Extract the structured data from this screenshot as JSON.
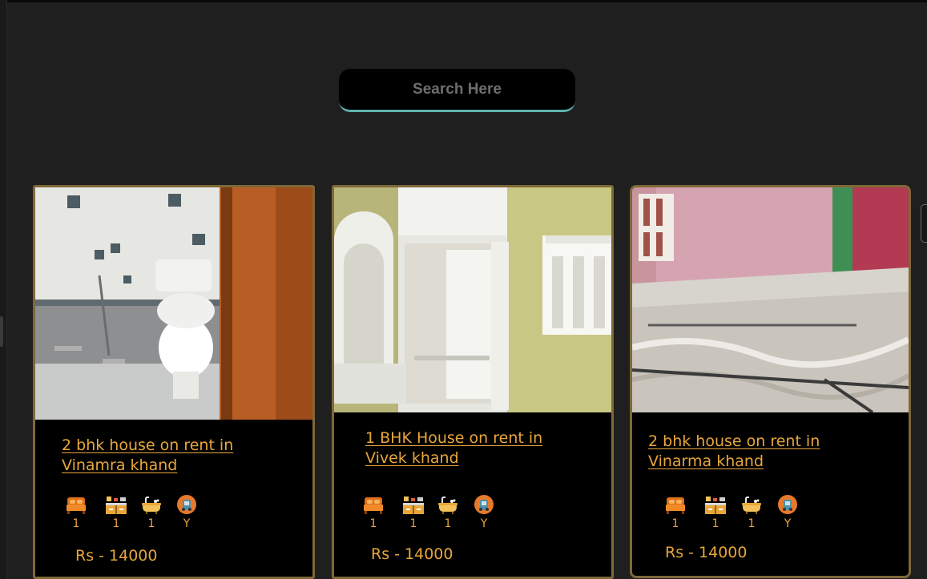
{
  "search": {
    "placeholder": "Search Here"
  },
  "listings": [
    {
      "title_line1": "2 bhk house on rent in",
      "title_line2": "Vinamra khand",
      "bedrooms": "1",
      "kitchen": "1",
      "bathrooms": "1",
      "parking": "Y",
      "price": "Rs - 14000",
      "photo": "bathroom-photo"
    },
    {
      "title_line1": "1 BHK House on rent in",
      "title_line2": "Vivek khand",
      "bedrooms": "1",
      "kitchen": "1",
      "bathrooms": "1",
      "parking": "Y",
      "price": "Rs - 14000",
      "photo": "cupboard-room-photo"
    },
    {
      "title_line1": "2 bhk house on rent in",
      "title_line2": "Vinarma khand",
      "bedrooms": "1",
      "kitchen": "1",
      "bathrooms": "1",
      "parking": "Y",
      "price": "Rs - 14000",
      "photo": "pink-room-photo"
    }
  ],
  "icons": [
    "bed-icon",
    "kitchen-icon",
    "bathtub-icon",
    "parking-icon"
  ],
  "colors": {
    "accent": "#e8a63a",
    "card_border": "#7f6838",
    "search_underline": "#5fb3b0",
    "background": "#1f1f1f"
  }
}
